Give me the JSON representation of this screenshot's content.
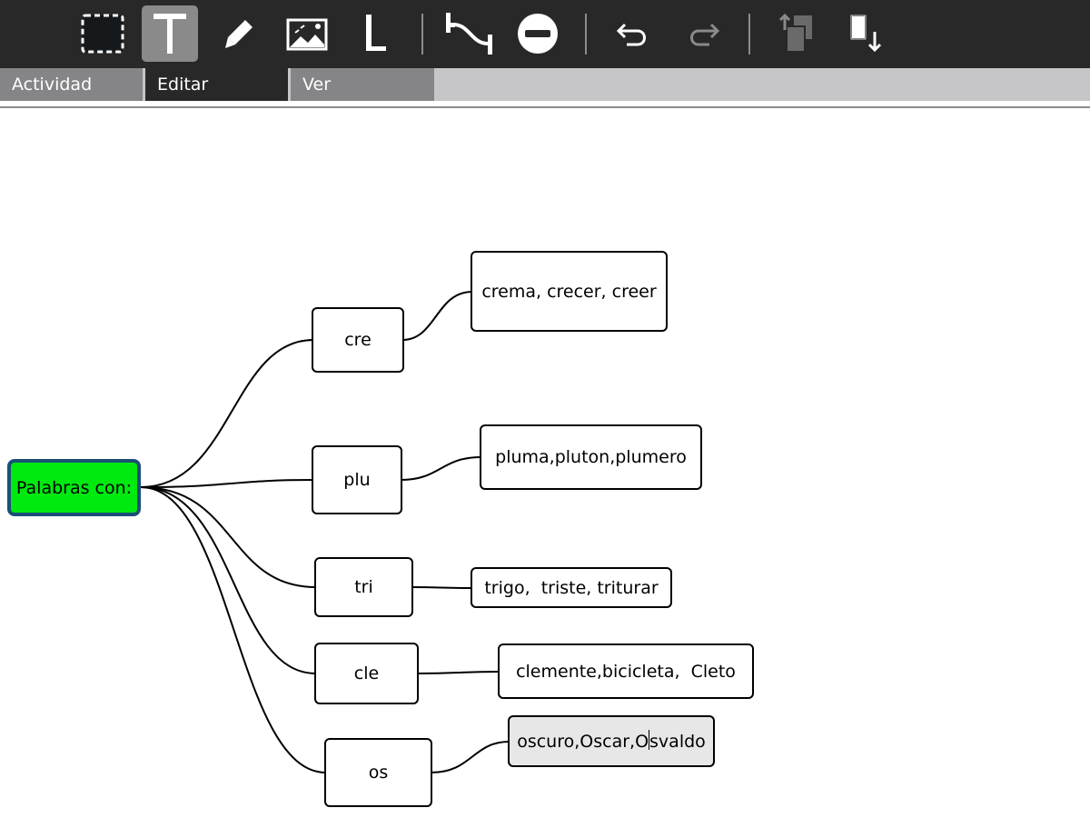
{
  "toolbar": {
    "tools": [
      {
        "name": "select-tool",
        "icon": "dashed-rectangle-icon"
      },
      {
        "name": "text-tool",
        "icon": "text-t-icon",
        "active": true
      },
      {
        "name": "pencil-tool",
        "icon": "pencil-icon"
      },
      {
        "name": "image-tool",
        "icon": "image-icon"
      },
      {
        "name": "label-tool",
        "icon": "letter-l-icon"
      },
      {
        "name": "link-tool",
        "icon": "connector-curve-icon"
      },
      {
        "name": "delete-tool",
        "icon": "minus-circle-icon"
      },
      {
        "name": "undo-button",
        "icon": "undo-icon"
      },
      {
        "name": "redo-button",
        "icon": "redo-icon",
        "disabled": true
      },
      {
        "name": "import-button",
        "icon": "import-pages-icon",
        "disabled": true
      },
      {
        "name": "export-button",
        "icon": "export-document-icon"
      }
    ]
  },
  "tabs": [
    {
      "label": "Actividad"
    },
    {
      "label": "Editar",
      "active": true
    },
    {
      "label": "Ver"
    }
  ],
  "mindmap": {
    "root": {
      "text": "Palabras con:",
      "color": "#00ea10",
      "border_color": "#1c4f75"
    },
    "branches": [
      {
        "syllable": "cre",
        "words": "crema, crecer, creer"
      },
      {
        "syllable": "plu",
        "words": "pluma,pluton,plumero"
      },
      {
        "syllable": "tri",
        "words": "trigo,  triste, triturar"
      },
      {
        "syllable": "cle",
        "words": "clemente,bicicleta,  Cleto"
      },
      {
        "syllable": "os",
        "words_before_caret": "oscuro,Oscar,O",
        "words_after_caret": "svaldo",
        "editing": true
      }
    ]
  },
  "colors": {
    "toolbar_bg": "#282828",
    "active_tool_bg": "#8a8a8a",
    "tab_bg": "#858487",
    "tabbar_bg": "#c6c5c8",
    "editing_node_bg": "#e7e7e7"
  }
}
